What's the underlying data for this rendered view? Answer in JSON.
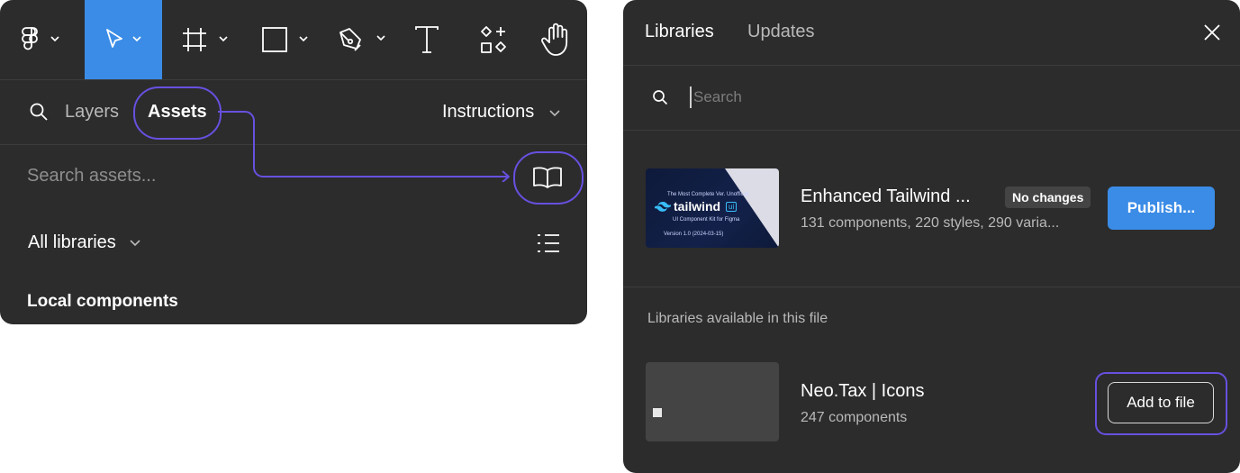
{
  "left_panel": {
    "toolbar": {
      "tools": [
        {
          "name": "main-menu",
          "icon": "figma-logo-icon"
        },
        {
          "name": "move",
          "icon": "cursor-arrow-icon",
          "active": true
        },
        {
          "name": "frame",
          "icon": "frame-hash-icon"
        },
        {
          "name": "shape",
          "icon": "rectangle-icon"
        },
        {
          "name": "pen",
          "icon": "pen-tool-icon"
        },
        {
          "name": "text",
          "icon": "text-t-icon"
        },
        {
          "name": "resources",
          "icon": "components-icon"
        },
        {
          "name": "hand",
          "icon": "hand-icon"
        }
      ]
    },
    "tabs": {
      "layers": "Layers",
      "assets": "Assets",
      "instructions": "Instructions"
    },
    "search": {
      "placeholder": "Search assets..."
    },
    "filter": {
      "label": "All libraries"
    },
    "section_title": "Local components"
  },
  "right_panel": {
    "tabs": {
      "libraries": "Libraries",
      "updates": "Updates"
    },
    "search": {
      "placeholder": "Search"
    },
    "current_library": {
      "name": "Enhanced Tailwind ...",
      "badge": "No changes",
      "details": "131 components, 220 styles, 290 varia...",
      "action": "Publish...",
      "thumbnail": {
        "brand": "tailwind",
        "brand_badge": "ui",
        "tagline": "The Most Complete Ver. Unofficial",
        "subtitle": "UI Component Kit for Figma",
        "version": "Version 1.0 (2024-03-15)"
      }
    },
    "available_header": "Libraries available in this file",
    "available_library": {
      "name": "Neo.Tax | Icons",
      "details": "247 components",
      "action": "Add to file"
    }
  },
  "colors": {
    "panel_bg": "#2c2c2c",
    "accent_blue": "#3b8ce6",
    "highlight_purple": "#6651e0",
    "divider": "#3c3c3c"
  }
}
